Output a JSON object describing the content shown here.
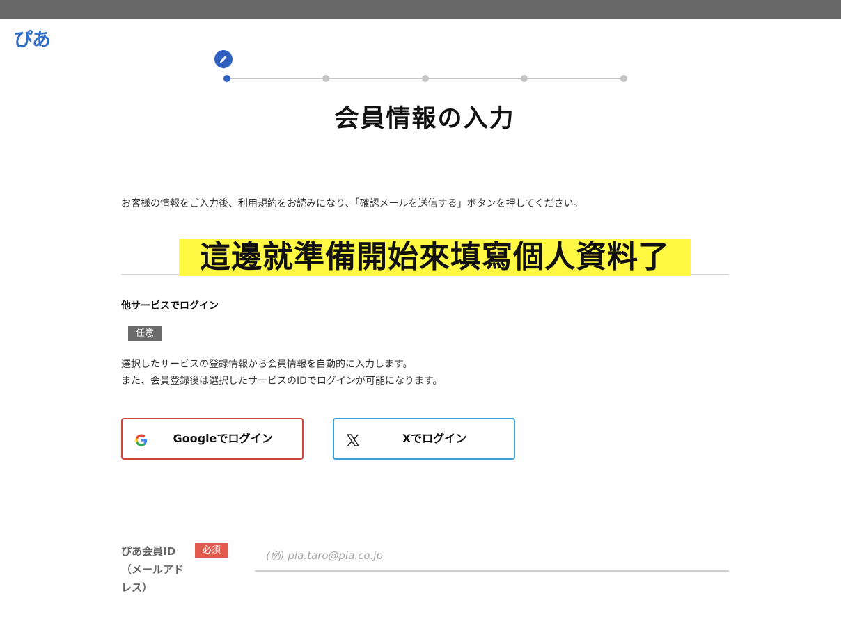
{
  "header": {
    "logo_text": "ぴあ"
  },
  "steps": {
    "count": 5,
    "active_index": 0,
    "marker_icon": "pencil-icon"
  },
  "main": {
    "title": "会員情報の入力",
    "instruction": "お客様の情報をご入力後、利用規約をお読みになり、「確認メールを送信する」ボタンを押してください。",
    "overlay_caption": "這邊就準備開始來填寫個人資料了"
  },
  "social_login": {
    "heading": "他サービスでログイン",
    "badge": "任意",
    "description_line1": "選択したサービスの登録情報から会員情報を自動的に入力します。",
    "description_line2": "また、会員登録後は選択したサービスのIDでログインが可能になります。",
    "google_label": "Googleでログイン",
    "google_icon": "google-icon",
    "x_label": "Xでログイン",
    "x_icon": "x-logo-icon"
  },
  "form": {
    "pia_id_label": "ぴあ会員ID（メールアドレス）",
    "required_badge": "必須",
    "pia_id_placeholder": "(例) pia.taro@pia.co.jp",
    "pia_id_value": ""
  },
  "colors": {
    "brand_blue": "#2f5fbf",
    "google_border": "#c9473b",
    "x_border": "#3ea0cf",
    "required_badge": "#e05a4e",
    "optional_badge": "#6b6b6b",
    "highlight": "#fff944"
  }
}
